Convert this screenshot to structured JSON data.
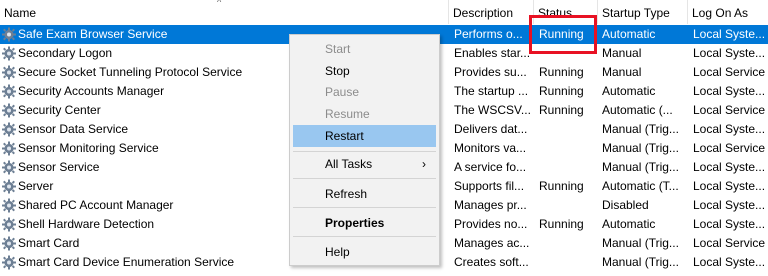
{
  "columns": {
    "name": "Name",
    "description": "Description",
    "status": "Status",
    "startup_type": "Startup Type",
    "log_on_as": "Log On As"
  },
  "rows": [
    {
      "name": "Safe Exam Browser Service",
      "description": "Performs o...",
      "status": "Running",
      "startup": "Automatic",
      "logon": "Local Syste..."
    },
    {
      "name": "Secondary Logon",
      "description": "Enables star...",
      "status": "",
      "startup": "Manual",
      "logon": "Local Syste..."
    },
    {
      "name": "Secure Socket Tunneling Protocol Service",
      "description": "Provides su...",
      "status": "Running",
      "startup": "Manual",
      "logon": "Local Service"
    },
    {
      "name": "Security Accounts Manager",
      "description": "The startup ...",
      "status": "Running",
      "startup": "Automatic",
      "logon": "Local Syste..."
    },
    {
      "name": "Security Center",
      "description": "The WSCSV...",
      "status": "Running",
      "startup": "Automatic (...",
      "logon": "Local Service"
    },
    {
      "name": "Sensor Data Service",
      "description": "Delivers dat...",
      "status": "",
      "startup": "Manual (Trig...",
      "logon": "Local Syste..."
    },
    {
      "name": "Sensor Monitoring Service",
      "description": "Monitors va...",
      "status": "",
      "startup": "Manual (Trig...",
      "logon": "Local Service"
    },
    {
      "name": "Sensor Service",
      "description": "A service fo...",
      "status": "",
      "startup": "Manual (Trig...",
      "logon": "Local Syste..."
    },
    {
      "name": "Server",
      "description": "Supports fil...",
      "status": "Running",
      "startup": "Automatic (T...",
      "logon": "Local Syste..."
    },
    {
      "name": "Shared PC Account Manager",
      "description": "Manages pr...",
      "status": "",
      "startup": "Disabled",
      "logon": "Local Syste..."
    },
    {
      "name": "Shell Hardware Detection",
      "description": "Provides no...",
      "status": "Running",
      "startup": "Automatic",
      "logon": "Local Syste..."
    },
    {
      "name": "Smart Card",
      "description": "Manages ac...",
      "status": "",
      "startup": "Manual (Trig...",
      "logon": "Local Service"
    },
    {
      "name": "Smart Card Device Enumeration Service",
      "description": "Creates soft...",
      "status": "",
      "startup": "Manual (Trig...",
      "logon": "Local Syste..."
    }
  ],
  "context_menu": {
    "start": "Start",
    "stop": "Stop",
    "pause": "Pause",
    "resume": "Resume",
    "restart": "Restart",
    "all_tasks": "All Tasks",
    "refresh": "Refresh",
    "properties": "Properties",
    "help": "Help"
  },
  "selection_color": "#0078d7",
  "menu_highlight_color": "#99c7f0",
  "annotation_color": "#e81123",
  "icons": {
    "service": "gear-icon",
    "submenu": "chevron-right-icon",
    "sort": "sort-up-icon"
  }
}
